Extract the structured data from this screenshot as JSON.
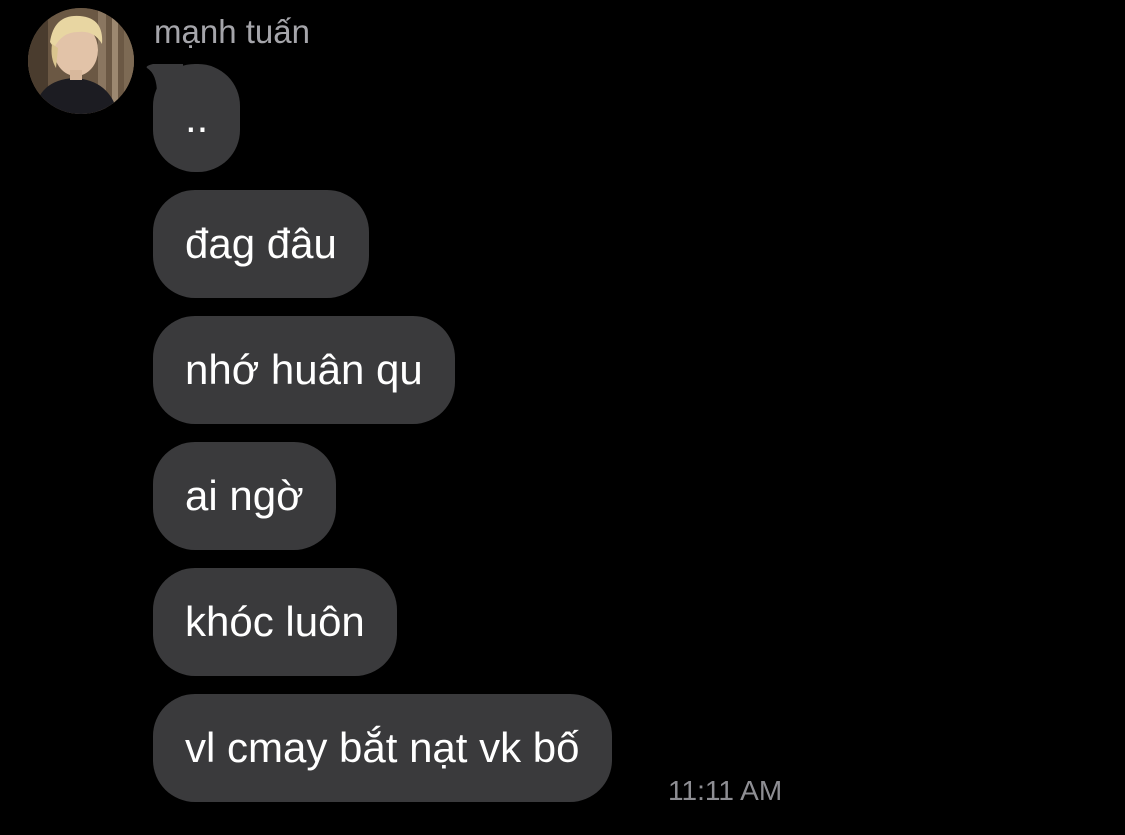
{
  "conversation": {
    "sender": {
      "name": "mạnh tuấn",
      "avatar": "profile-photo-avatar"
    },
    "messages": [
      {
        "text": ".."
      },
      {
        "text": "đag đâu"
      },
      {
        "text": "nhớ huân qu"
      },
      {
        "text": "ai ngờ"
      },
      {
        "text": "khóc luôn"
      },
      {
        "text": "vl cmay bắt nạt vk bố"
      }
    ],
    "last_message_time": "11:11 AM"
  },
  "colors": {
    "background": "#000000",
    "bubble": "#3a3a3c",
    "message_text": "#ffffff",
    "sender_name": "#a5a5aa",
    "timestamp": "#8e8e93"
  }
}
